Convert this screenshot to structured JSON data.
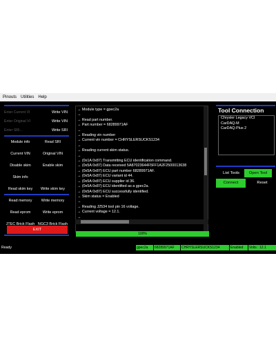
{
  "menu": [
    "Pinouts",
    "Utilities",
    "Help"
  ],
  "sri": [
    {
      "placeholder": "Enter Current VI",
      "button": "Write VIN"
    },
    {
      "placeholder": "Enter Original VI",
      "button": "Write VIN"
    },
    {
      "placeholder": "Enter SRI...",
      "button": "Write SRI"
    }
  ],
  "buttons": [
    "Module info",
    "Read SRI",
    "Current VIN",
    "Original VIN",
    "Disable skim",
    "Enable skim",
    "Skim info",
    "",
    "Read skim key",
    "Write skim key",
    "Read memory",
    "Write memory",
    "Read eprom",
    "Write eprom",
    "JTEC Brick Flash",
    "NGC3 Brick Flash"
  ],
  "exit_label": "EXIT",
  "log": [
    "→ Module type = gpec2a",
    "→",
    "→ Read part number.",
    "→ Part number = 68289971AF",
    "→",
    "→ Reading vin number",
    "→ Current vin number = CHRYSLERSUCKS1234",
    "→",
    "→ Reading current skim status.",
    "→",
    "→ (0x1A 0x87) Transmitting ECU identification command.",
    "→ (0x5A 0x87) Data received 5A87023644F5FF1A2F2500013638",
    "→ (0x5A 0x87) ECU part number 68289971AF.",
    "→ (0x5A 0x87) ECU variant id 44.",
    "→ (0x5A 0x87) ECU supplier id 36.",
    "→ (0x5A 0x87) ECU identified as a gpec2a.",
    "→ (0x5A 0x87) ECU successfully identified.",
    "→ Skim status = Enabled",
    "→",
    "→ Reading J2534 tool pin 16 voltage.",
    "→ Current voltage = 12.1.",
    "→"
  ],
  "progress": {
    "value": 1.0,
    "label": "100%"
  },
  "tool_connection": {
    "title": "Tool Connection",
    "tools": [
      "Chrysler Legacy VCI",
      "CarDAQ-M",
      "CarDAQ-Plus 2"
    ],
    "list_tools_label": "List Tools",
    "open_tool_label": "Open Tool",
    "connect_label": "Connect",
    "reset_label": "Reset"
  },
  "status": {
    "ready": "Ready",
    "module": "gpec2a",
    "part": "68289971AF",
    "vin": "CHRYSLERSUCKS1234",
    "skim": "Enabled",
    "volts": "Volts : 12.1"
  },
  "colors": {
    "accent_green": "#2ecc2e",
    "exit_red": "#e01818",
    "divider_blue": "#1e3cc8"
  }
}
